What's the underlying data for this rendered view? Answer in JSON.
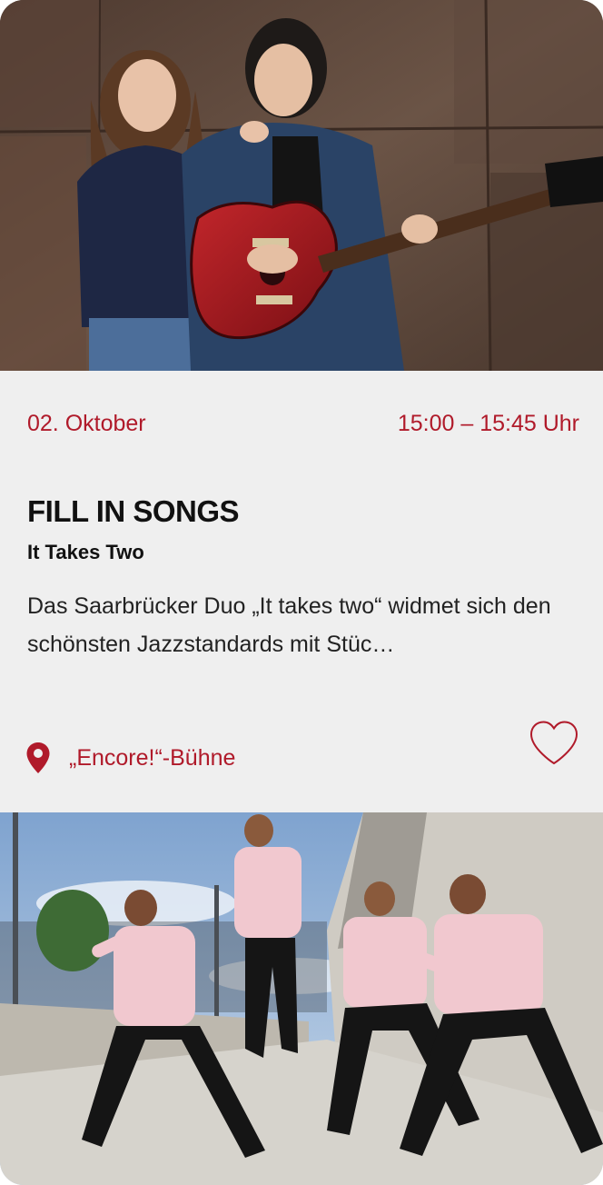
{
  "events": [
    {
      "image_alt": "Duo with guitar in front of a rusty wall",
      "date": "02. Oktober",
      "time": "15:00 – 15:45 Uhr",
      "title": "FILL IN SONGS",
      "subtitle": "It Takes Two",
      "description": "Das Saarbrücker Duo „It takes two“ widmet sich den schönsten Jazzstandards mit Stüc…",
      "location": "„Encore!“-Bühne",
      "icons": {
        "location": "map-pin-icon",
        "favorite": "heart-outline-icon"
      }
    },
    {
      "image_alt": "Four dancers in pink shirts posing outdoors"
    }
  ],
  "colors": {
    "accent": "#b01a2a",
    "card_background": "#efefef",
    "text": "#111111"
  }
}
